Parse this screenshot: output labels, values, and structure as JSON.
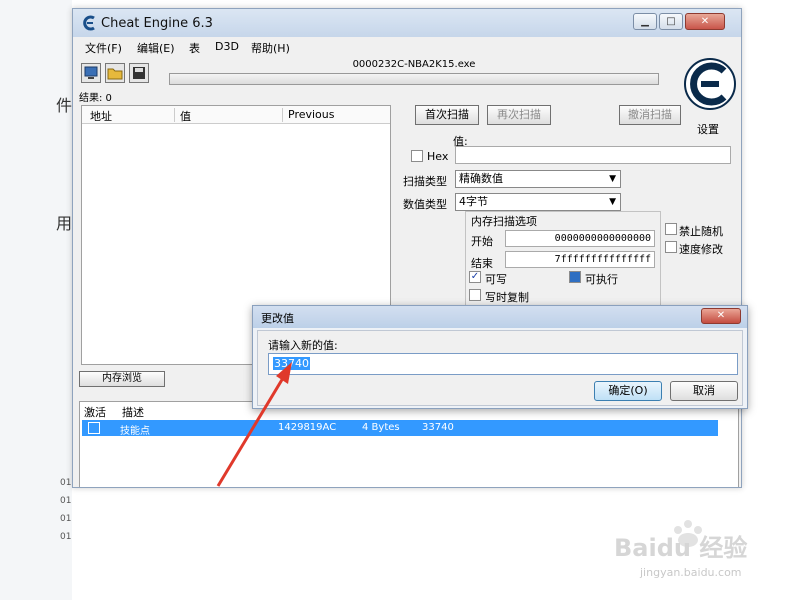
{
  "window": {
    "title": "Cheat Engine 6.3"
  },
  "menu": [
    "文件(F)",
    "编辑(E)",
    "表",
    "D3D",
    "帮助(H)"
  ],
  "process_name": "0000232C-NBA2K15.exe",
  "results": "结果: 0",
  "settings_label": "设置",
  "address_list": {
    "columns": [
      "地址",
      "值",
      "Previous"
    ]
  },
  "scan": {
    "first_scan": "首次扫描",
    "next_scan": "再次扫描",
    "undo_scan": "撤消扫描",
    "value_label": "值:",
    "hex_label": "Hex",
    "scan_type_label": "扫描类型",
    "scan_type_value": "精确数值",
    "value_type_label": "数值类型",
    "value_type_value": "4字节",
    "mem_options_title": "内存扫描选项",
    "start_label": "开始",
    "start_value": "0000000000000000",
    "stop_label": "结束",
    "stop_value": "7fffffffffffffff",
    "writable_label": "可写",
    "executable_label": "可执行",
    "copy_on_write_label": "写时复制",
    "disable_random_label": "禁止随机",
    "speedhack_label": "速度修改"
  },
  "memory_view_button": "内存浏览",
  "cheat_table": {
    "columns": [
      "激活",
      "描述"
    ],
    "rows": [
      {
        "description": "技能点",
        "address": "1429819AC",
        "type": "4 Bytes",
        "value": "33740"
      }
    ]
  },
  "dialog": {
    "title": "更改值",
    "prompt": "请输入新的值:",
    "value": "33740",
    "ok_label": "确定(O)",
    "cancel_label": "取消"
  },
  "colors": {
    "selection": "#3399ff",
    "accent_arrow": "#e0392b",
    "titlebar": "#c6d6ea"
  }
}
